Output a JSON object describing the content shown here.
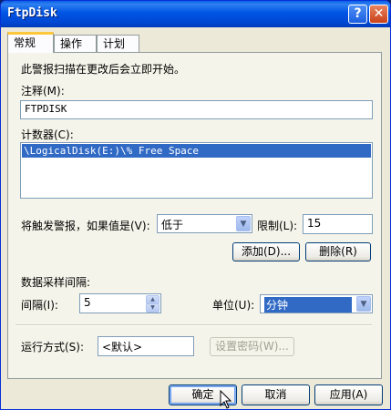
{
  "window": {
    "title": "FtpDisk",
    "help_glyph": "?",
    "close_glyph": "✕"
  },
  "tabs": [
    {
      "label": "常规"
    },
    {
      "label": "操作"
    },
    {
      "label": "计划"
    }
  ],
  "general": {
    "intro_text": "此警报扫描在更改后会立即开始。",
    "comment_label": "注释(M):",
    "comment_value": "FTPDISK",
    "counter_label": "计数器(C):",
    "counters": [
      "\\LogicalDisk(E:)\\% Free Space"
    ],
    "trigger_label": "将触发警报，如果值是(V):",
    "trigger_condition": "低于",
    "limit_label": "限制(L):",
    "limit_value": "15",
    "add_button": "添加(D)...",
    "remove_button": "删除(R)",
    "sample_interval_label": "数据采样间隔:",
    "interval_label": "间隔(I):",
    "interval_value": "5",
    "units_label": "单位(U):",
    "units_value": "分钟",
    "run_as_label": "运行方式(S):",
    "run_as_value": "<默认>",
    "set_password_button": "设置密码(W)..."
  },
  "footer": {
    "ok_button": "确定",
    "cancel_button": "取消",
    "apply_button": "应用(A)"
  },
  "colors": {
    "titlebar": "#0055e5",
    "selection": "#316ac5",
    "dialog_bg": "#ece9d8"
  }
}
